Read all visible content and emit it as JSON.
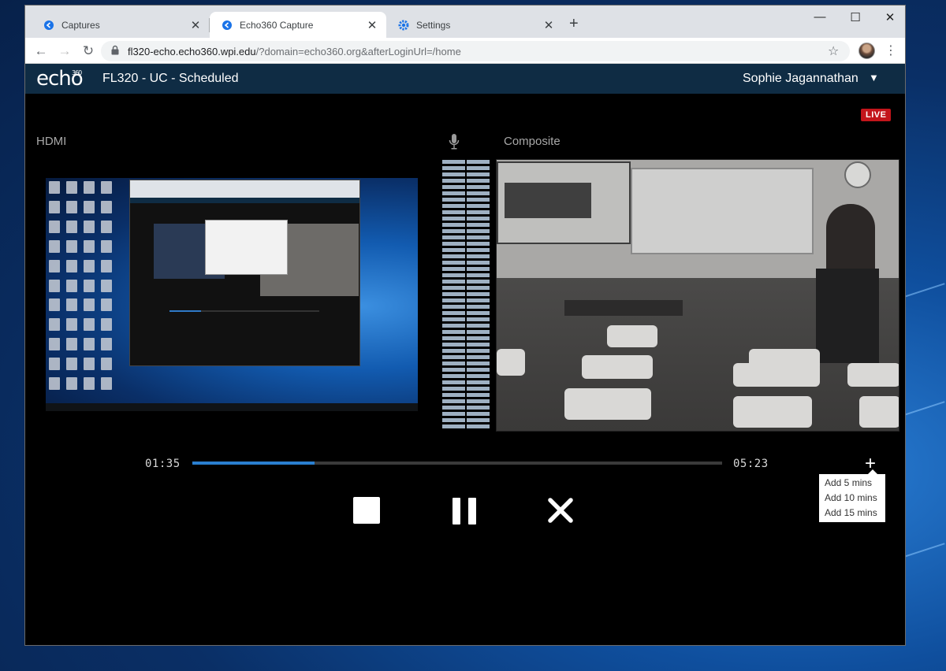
{
  "browser": {
    "tabs": [
      {
        "label": "Captures",
        "icon": "echo360-icon"
      },
      {
        "label": "Echo360 Capture",
        "icon": "echo360-icon",
        "active": true
      },
      {
        "label": "Settings",
        "icon": "gear-icon"
      }
    ],
    "new_tab_glyph": "+",
    "url_host": "fl320-echo.echo360.wpi.edu",
    "url_rest": "/?domain=echo360.org&afterLoginUrl=/home"
  },
  "app": {
    "logo": "echo",
    "logo_sup": "360",
    "room_title": "FL320 - UC - Scheduled",
    "user_name": "Sophie Jagannathan"
  },
  "capture": {
    "live_label": "LIVE",
    "source_left": "HDMI",
    "source_right": "Composite",
    "elapsed": "01:35",
    "remaining": "05:23",
    "progress_fraction": 0.23
  },
  "add_time_menu": [
    "Add 5 mins",
    "Add 10 mins",
    "Add 15 mins"
  ],
  "colors": {
    "header_bg": "#0f2c44",
    "live_red": "#c3151b",
    "progress_blue": "#2a7fd0",
    "accent_tab_icon": "#1a73e8"
  }
}
